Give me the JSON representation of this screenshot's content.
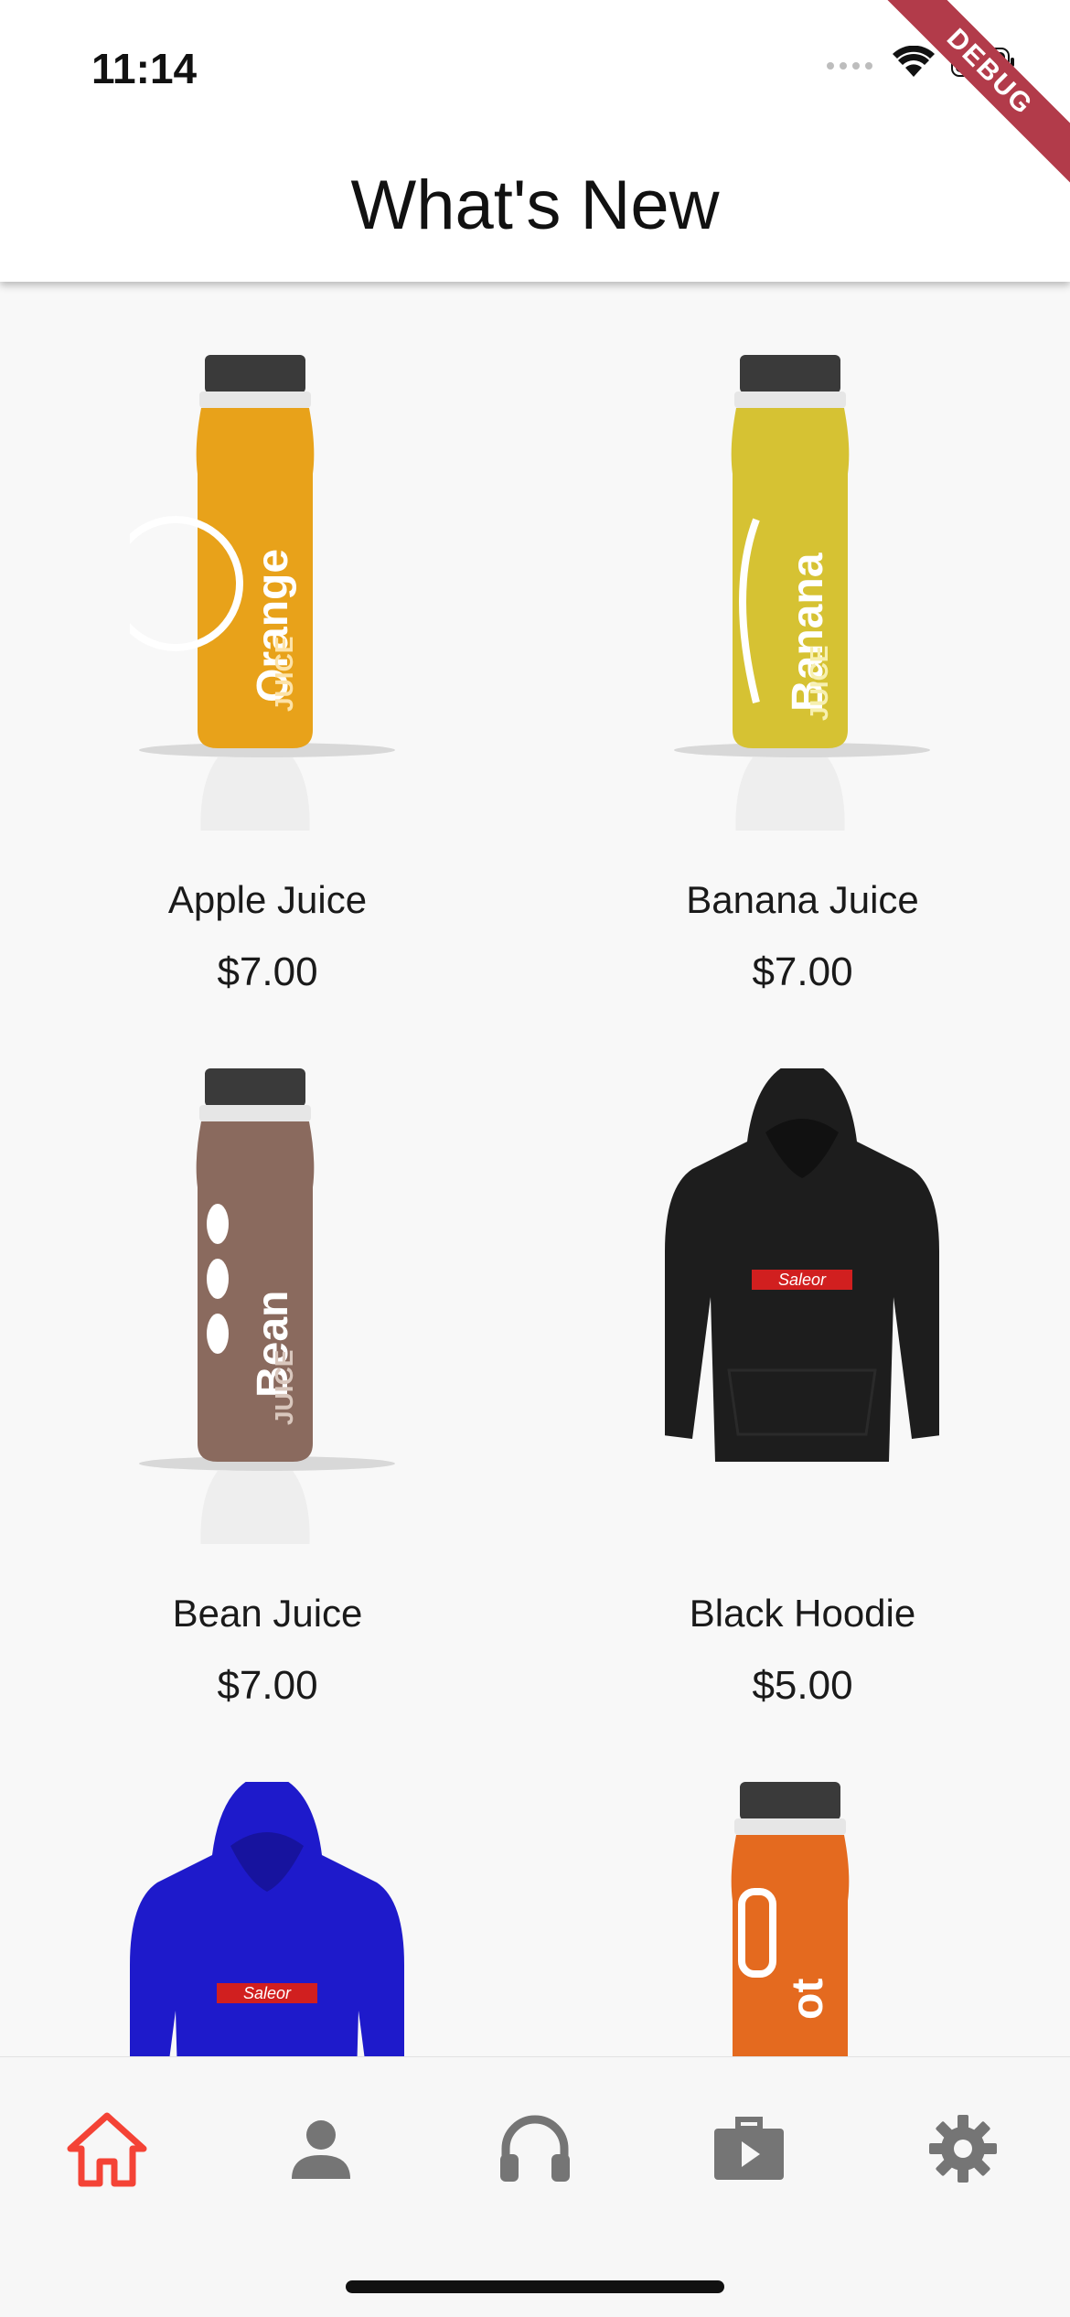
{
  "status_bar": {
    "time": "11:14"
  },
  "debug_banner": "DEBUG",
  "app_bar": {
    "title": "What's New"
  },
  "products": [
    {
      "name": "Apple Juice",
      "price": "$7.00",
      "image": "juice-bottle",
      "bottle_label": "Orange",
      "color": "#e8a21a"
    },
    {
      "name": "Banana Juice",
      "price": "$7.00",
      "image": "juice-bottle",
      "bottle_label": "Banana",
      "color": "#d6c233"
    },
    {
      "name": "Bean Juice",
      "price": "$7.00",
      "image": "juice-bottle",
      "bottle_label": "Bean",
      "color": "#8a6a5e"
    },
    {
      "name": "Black Hoodie",
      "price": "$5.00",
      "image": "hoodie",
      "hoodie_label": "Saleor",
      "color": "#1d1d1d"
    },
    {
      "name": "",
      "price": "",
      "image": "hoodie",
      "hoodie_label": "Saleor",
      "color": "#1e1acb"
    },
    {
      "name": "",
      "price": "",
      "image": "juice-bottle",
      "bottle_label": "ot",
      "color": "#e46a1f"
    }
  ],
  "bottom_nav": {
    "items": [
      {
        "icon": "home-icon",
        "active": true
      },
      {
        "icon": "person-icon",
        "active": false
      },
      {
        "icon": "headphones-icon",
        "active": false
      },
      {
        "icon": "briefcase-play-icon",
        "active": false
      },
      {
        "icon": "gear-icon",
        "active": false
      }
    ],
    "active_color": "#f44336",
    "inactive_color": "#757575"
  }
}
